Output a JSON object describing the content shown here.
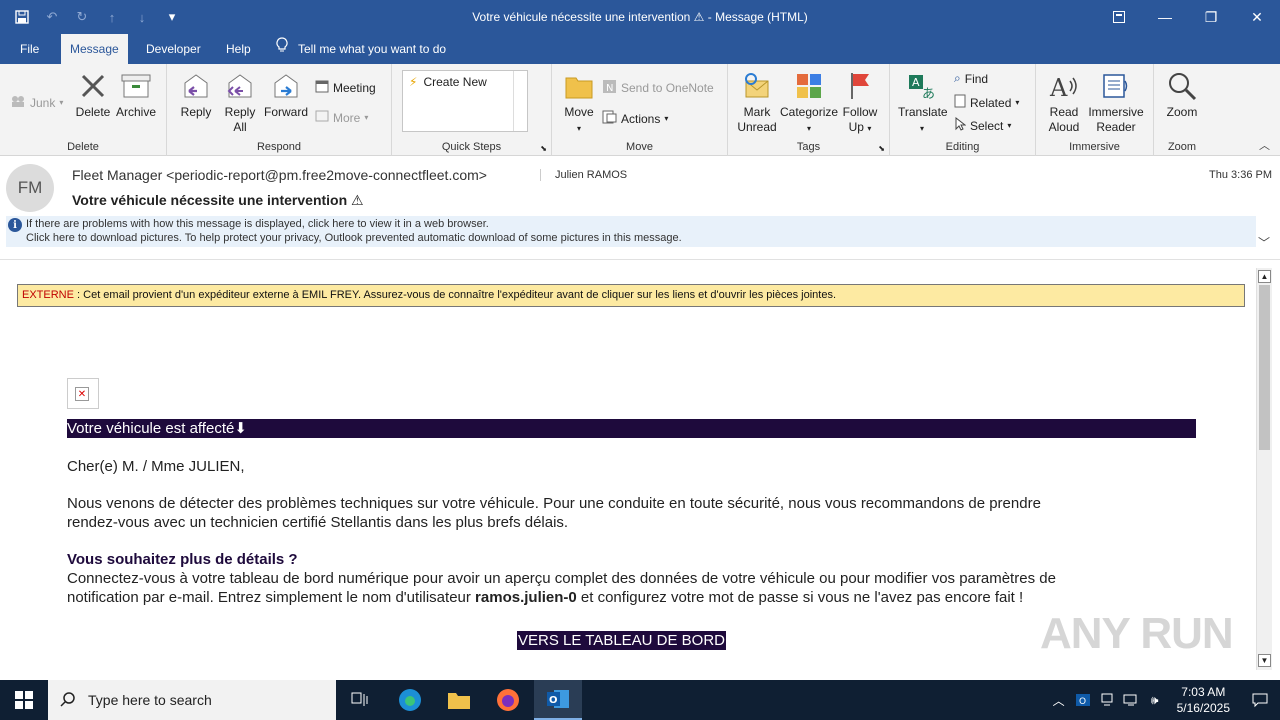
{
  "window": {
    "title": "Votre véhicule nécessite une intervention ⚠  -  Message (HTML)"
  },
  "tabs": [
    {
      "label": "File"
    },
    {
      "label": "Message"
    },
    {
      "label": "Developer"
    },
    {
      "label": "Help"
    }
  ],
  "tell_me": "Tell me what you want to do",
  "ribbon": {
    "delete_group": {
      "junk": "Junk",
      "delete": "Delete",
      "archive": "Archive",
      "label": "Delete"
    },
    "respond_group": {
      "reply": "Reply",
      "reply_all_1": "Reply",
      "reply_all_2": "All",
      "forward": "Forward",
      "meeting": "Meeting",
      "more": "More",
      "label": "Respond"
    },
    "quicksteps_group": {
      "create_new": "Create New",
      "label": "Quick Steps"
    },
    "move_group": {
      "move": "Move",
      "onenote": "Send to OneNote",
      "actions": "Actions",
      "label": "Move"
    },
    "tags_group": {
      "mark_1": "Mark",
      "mark_2": "Unread",
      "categorize": "Categorize",
      "follow_1": "Follow",
      "follow_2": "Up",
      "label": "Tags"
    },
    "editing_group": {
      "translate": "Translate",
      "find": "Find",
      "related": "Related",
      "select": "Select",
      "label": "Editing"
    },
    "immersive_group": {
      "read_1": "Read",
      "read_2": "Aloud",
      "reader_1": "Immersive",
      "reader_2": "Reader",
      "label": "Immersive"
    },
    "zoom_group": {
      "zoom": "Zoom",
      "label": "Zoom"
    }
  },
  "message": {
    "avatar_initials": "FM",
    "from": "Fleet Manager <periodic-report@pm.free2move-connectfleet.com>",
    "to": "Julien RAMOS",
    "time": "Thu 3:36 PM",
    "subject": "Votre véhicule nécessite une intervention ⚠",
    "info_line1": "If there are problems with how this message is displayed, click here to view it in a web browser.",
    "info_line2": "Click here to download pictures. To help protect your privacy, Outlook prevented automatic download of some pictures in this message."
  },
  "body": {
    "external_tag": "EXTERNE",
    "external_text": " : Cet email provient d'un expéditeur externe à EMIL FREY. Assurez-vous de connaître l'expéditeur avant de cliquer sur les liens et d'ouvrir les pièces jointes.",
    "banner_title": "Votre véhicule est affecté⬇",
    "greeting": "Cher(e) M. / Mme JULIEN,",
    "para1_line1": "Nous venons de détecter des problèmes techniques sur votre véhicule. Pour une conduite en toute sécurité, nous vous recommandons de prendre",
    "para1_line2": "rendez-vous avec un technicien certifié Stellantis dans les plus brefs délais.",
    "heading": "Vous souhaitez plus de détails ?",
    "para2_line1": "Connectez-vous à votre tableau de bord numérique pour avoir un aperçu complet des données de votre véhicule ou pour modifier vos paramètres de",
    "para2_line2_a": "notification par e-mail. Entrez simplement le nom d'utilisateur ",
    "username": "ramos.julien-0",
    "para2_line2_b": " et configurez votre mot de passe si vous ne l'avez pas encore fait !",
    "cta": "VERS LE TABLEAU DE BORD",
    "watermark": "ANY RUN"
  },
  "taskbar": {
    "search_placeholder": "Type here to search",
    "time": "7:03 AM",
    "date": "5/16/2025"
  }
}
